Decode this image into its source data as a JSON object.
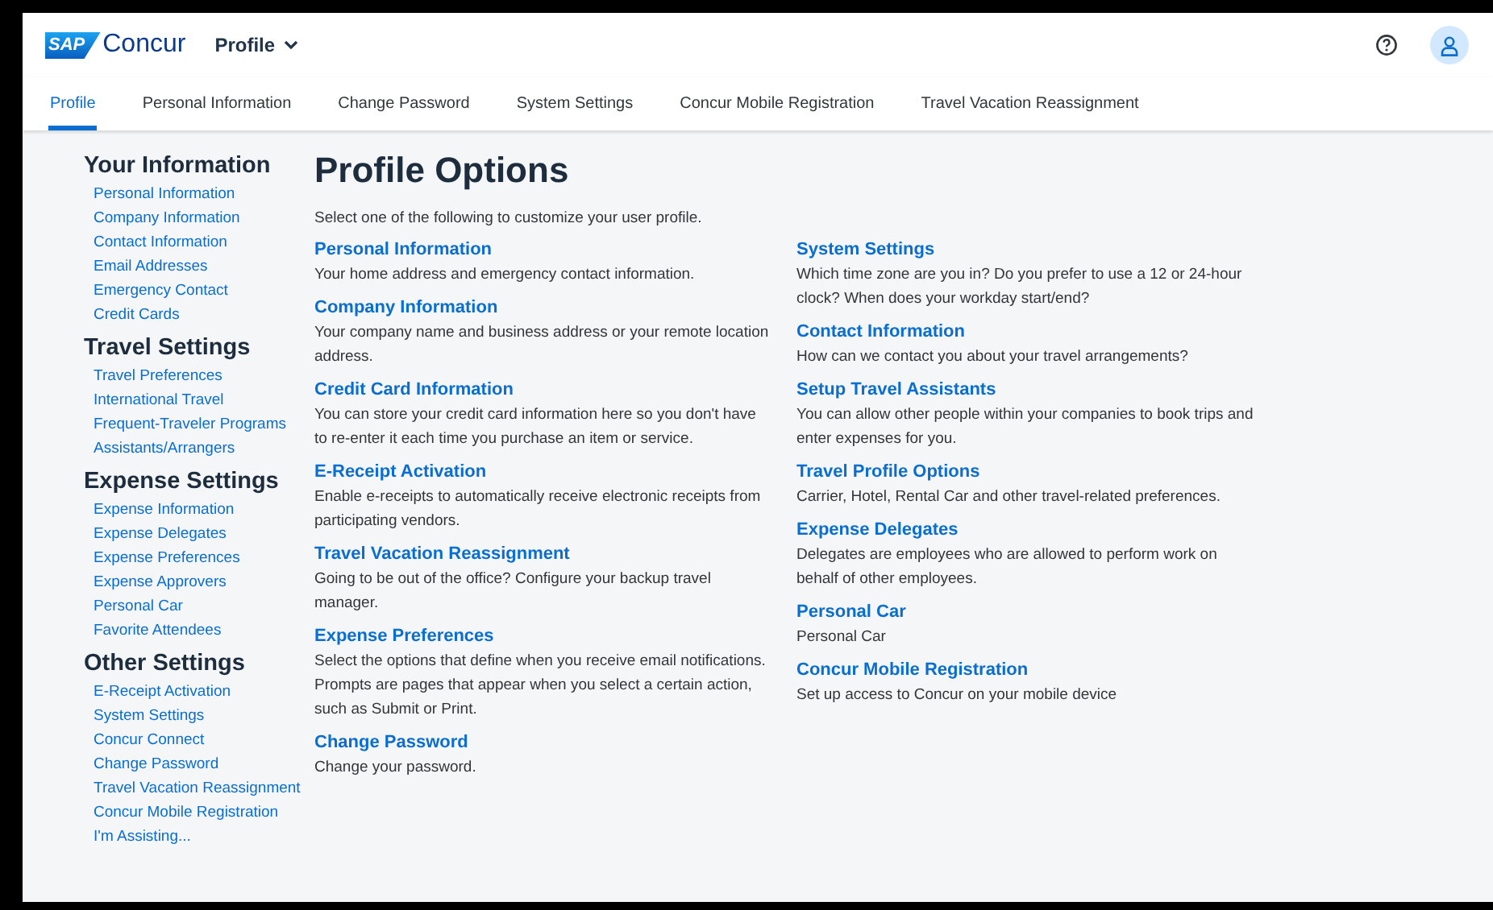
{
  "header": {
    "logo_mark": "SAP",
    "logo_text": "Concur",
    "app_menu": "Profile"
  },
  "tabs": [
    {
      "label": "Profile",
      "selected": true
    },
    {
      "label": "Personal Information",
      "selected": false
    },
    {
      "label": "Change Password",
      "selected": false
    },
    {
      "label": "System Settings",
      "selected": false
    },
    {
      "label": "Concur Mobile Registration",
      "selected": false
    },
    {
      "label": "Travel Vacation Reassignment",
      "selected": false
    }
  ],
  "sidebar": {
    "sections": [
      {
        "title": "Your Information",
        "items": [
          "Personal Information",
          "Company Information",
          "Contact Information",
          "Email Addresses",
          "Emergency Contact",
          "Credit Cards"
        ]
      },
      {
        "title": "Travel Settings",
        "items": [
          "Travel Preferences",
          "International Travel",
          "Frequent-Traveler Programs",
          "Assistants/Arrangers"
        ]
      },
      {
        "title": "Expense Settings",
        "items": [
          "Expense Information",
          "Expense Delegates",
          "Expense Preferences",
          "Expense Approvers",
          "Personal Car",
          "Favorite Attendees"
        ]
      },
      {
        "title": "Other Settings",
        "items": [
          "E-Receipt Activation",
          "System Settings",
          "Concur Connect",
          "Change Password",
          "Travel Vacation Reassignment",
          "Concur Mobile Registration",
          "I'm Assisting..."
        ]
      }
    ]
  },
  "main": {
    "title": "Profile Options",
    "intro": "Select one of the following to customize your user profile.",
    "columns": [
      [
        {
          "title": "Personal Information",
          "description": "Your home address and emergency contact information."
        },
        {
          "title": "Company Information",
          "description": "Your company name and business address or your remote location address."
        },
        {
          "title": "Credit Card Information",
          "description": "You can store your credit card information here so you don't have to re-enter it each time you purchase an item or service."
        },
        {
          "title": "E-Receipt Activation",
          "description": "Enable e-receipts to automatically receive electronic receipts from participating vendors."
        },
        {
          "title": "Travel Vacation Reassignment",
          "description": "Going to be out of the office? Configure your backup travel manager."
        },
        {
          "title": "Expense Preferences",
          "description": "Select the options that define when you receive email notifications. Prompts are pages that appear when you select a certain action, such as Submit or Print."
        },
        {
          "title": "Change Password",
          "description": "Change your password."
        }
      ],
      [
        {
          "title": "System Settings",
          "description": "Which time zone are you in? Do you prefer to use a 12 or 24-hour clock? When does your workday start/end?"
        },
        {
          "title": "Contact Information",
          "description": "How can we contact you about your travel arrangements?"
        },
        {
          "title": "Setup Travel Assistants",
          "description": "You can allow other people within your companies to book trips and enter expenses for you."
        },
        {
          "title": "Travel Profile Options",
          "description": "Carrier, Hotel, Rental Car and other travel-related preferences."
        },
        {
          "title": "Expense Delegates",
          "description": "Delegates are employees who are allowed to perform work on behalf of other employees."
        },
        {
          "title": "Personal Car",
          "description": "Personal Car"
        },
        {
          "title": "Concur Mobile Registration",
          "description": "Set up access to Concur on your mobile device"
        }
      ]
    ]
  }
}
